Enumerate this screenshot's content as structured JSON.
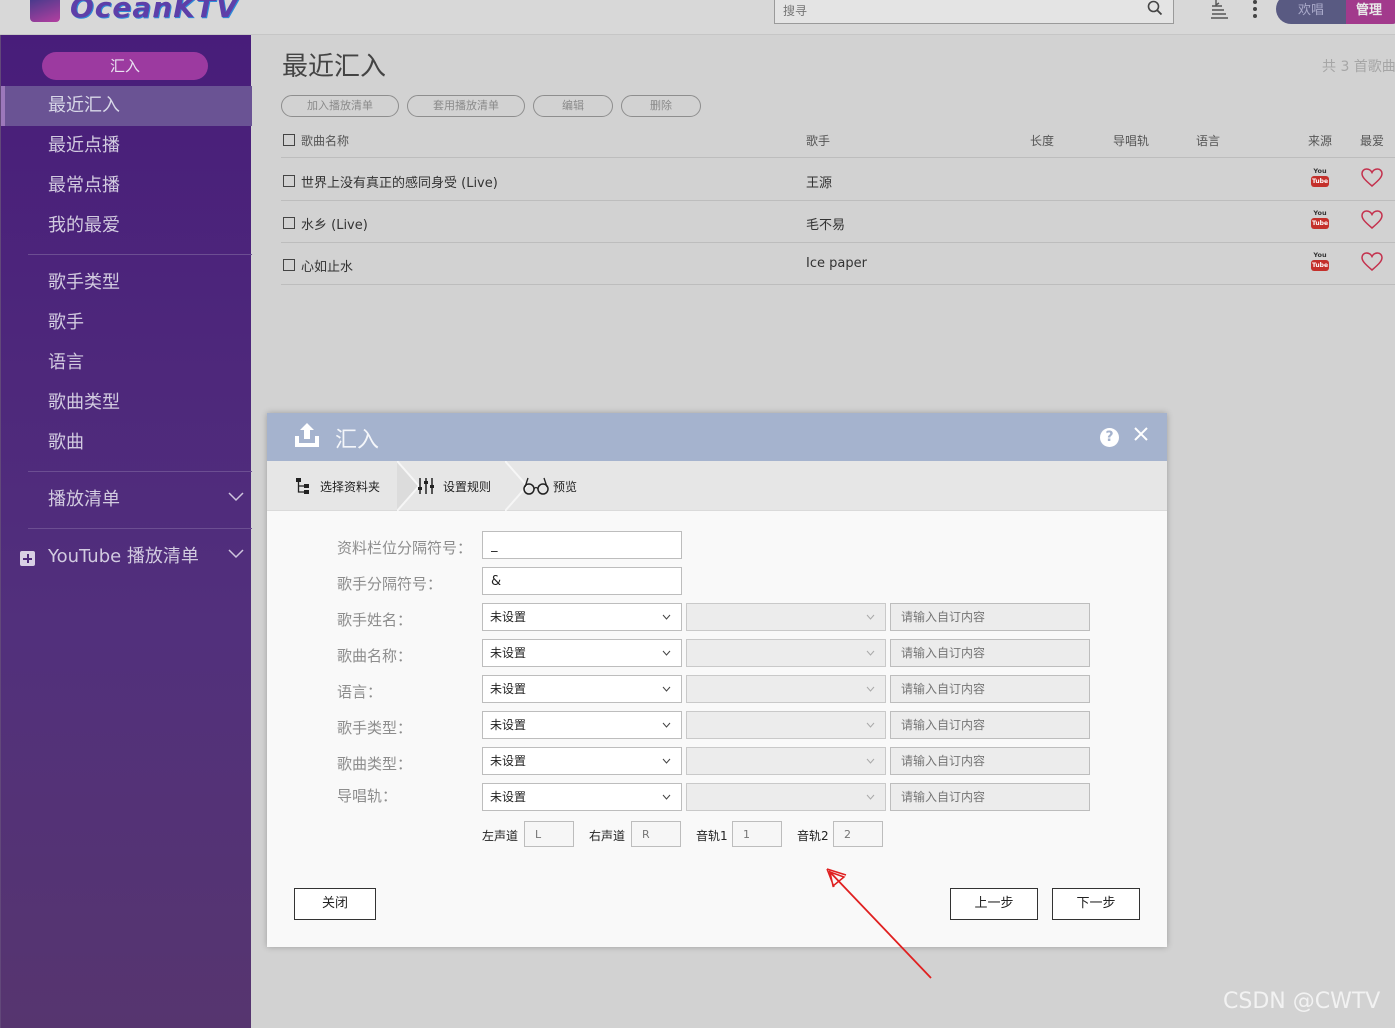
{
  "app": {
    "brand": "OceanKTV"
  },
  "header": {
    "search_placeholder": "搜寻",
    "pill_left": "欢唱",
    "pill_right": "管理"
  },
  "sidebar": {
    "import_button": "汇入",
    "items": [
      {
        "label": "最近汇入",
        "active": true
      },
      {
        "label": "最近点播"
      },
      {
        "label": "最常点播"
      },
      {
        "label": "我的最爱"
      },
      {
        "label": "歌手类型"
      },
      {
        "label": "歌手"
      },
      {
        "label": "语言"
      },
      {
        "label": "歌曲类型"
      },
      {
        "label": "歌曲"
      },
      {
        "label": "播放清单"
      },
      {
        "label": "YouTube 播放清单"
      }
    ]
  },
  "main": {
    "title": "最近汇入",
    "count_text": "共 3 首歌曲",
    "actions": [
      "加入播放清单",
      "套用播放清单",
      "编辑",
      "删除"
    ],
    "columns": [
      "歌曲名称",
      "歌手",
      "长度",
      "导唱轨",
      "语言",
      "来源",
      "最爱"
    ],
    "rows": [
      {
        "title": "世界上没有真正的感同身受 (Live)",
        "artist": "王源",
        "source": "YouTube"
      },
      {
        "title": "水乡 (Live)",
        "artist": "毛不易",
        "source": "YouTube"
      },
      {
        "title": "心如止水",
        "artist": "Ice paper",
        "source": "YouTube"
      }
    ]
  },
  "dialog": {
    "title": "汇入",
    "help": "?",
    "steps": [
      "选择资料夹",
      "设置规则",
      "预览"
    ],
    "fields": {
      "field_sep_label": "资料栏位分隔符号：",
      "field_sep_value": "_",
      "artist_sep_label": "歌手分隔符号：",
      "artist_sep_value": "&"
    },
    "rules": [
      {
        "label": "歌手姓名：",
        "value": "未设置",
        "placeholder": "请输入自订内容"
      },
      {
        "label": "歌曲名称：",
        "value": "未设置",
        "placeholder": "请输入自订内容"
      },
      {
        "label": "语言：",
        "value": "未设置",
        "placeholder": "请输入自订内容"
      },
      {
        "label": "歌手类型：",
        "value": "未设置",
        "placeholder": "请输入自订内容"
      },
      {
        "label": "歌曲类型：",
        "value": "未设置",
        "placeholder": "请输入自订内容"
      },
      {
        "label": "导唱轨：",
        "value": "未设置",
        "placeholder": "请输入自订内容"
      }
    ],
    "channels": [
      {
        "label": "左声道",
        "placeholder": "L"
      },
      {
        "label": "右声道",
        "placeholder": "R"
      },
      {
        "label": "音轨1",
        "placeholder": "1"
      },
      {
        "label": "音轨2",
        "placeholder": "2"
      }
    ],
    "buttons": {
      "close": "关闭",
      "prev": "上一步",
      "next": "下一步"
    }
  },
  "watermark": "CSDN @CWTV",
  "colors": {
    "sidebar": "#4a1f7c",
    "accent": "#9c3aa0",
    "dialog_header": "#a5b3ce",
    "annotation": "#e02020"
  }
}
